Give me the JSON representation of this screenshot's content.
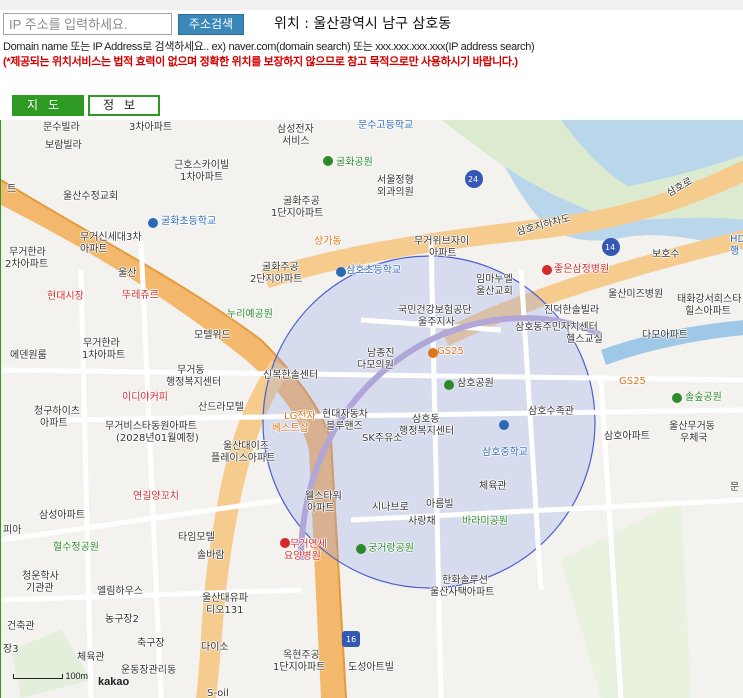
{
  "search": {
    "placeholder": "IP 주소를 입력하세요.",
    "button_label": "주소검색"
  },
  "location_text": "위치 : 울산광역시 남구 삼호동",
  "help_text": "Domain name 또는 IP Address로 검색하세요.. ex) naver.com(domain search) 또는 xxx.xxx.xxx.xxx(IP address search)",
  "warning_text": "(*제공되는 위치서비스는 법적 효력이 없으며 정확한 위치를 보장하지 않으므로 참고 목적으로만 사용하시기 바랍니다.)",
  "tabs": [
    {
      "label": "지도"
    },
    {
      "label": "정보"
    }
  ],
  "map": {
    "labels": [
      "문수빌라",
      "3차아파트",
      "삼성전자",
      "서비스",
      "문수고등학교",
      "보람빌라",
      "근호스카이빌",
      "1차아파트",
      "굴화공원",
      "서울정형",
      "외과의원",
      "울산수정교회",
      "굴화초등학교",
      "굴화주공",
      "1단지아파트",
      "무거신세대3차",
      "아파트",
      "상가동",
      "무거위브자이",
      "아파트",
      "무거한라",
      "2차아파트",
      "울산",
      "굴화주공",
      "2단지아파트",
      "삼호초등학교",
      "임마누엘",
      "울산교회",
      "좋은삼정병원",
      "보호수",
      "울산미즈병원",
      "태화강서희스타",
      "힐스아파트",
      "현대시장",
      "뚜레쥬르",
      "누리예공원",
      "국민건강보험공단",
      "울주지사",
      "진덕한솔빌라",
      "모텔위드",
      "무거한라",
      "1차아파트",
      "삼호동주민자치센터",
      "헬스교실",
      "다모아파트",
      "에덴원룸",
      "남종진",
      "다모의원",
      "GS25",
      "신복한솔센터",
      "무거동",
      "행정복지센터",
      "삼호공원",
      "이디야커피",
      "GS25",
      "산드라모텔",
      "솔숲공원",
      "청구하이츠",
      "아파트",
      "LG전자",
      "베스트샵",
      "현대자동차",
      "블루핸즈",
      "삼호동",
      "행정복지센터",
      "삼호수족관",
      "울산무거동",
      "우체국",
      "무거비스타동원아파트",
      "(2028년01월예정)",
      "울산대이즈",
      "플레이스아파트",
      "SK주유소",
      "삼호중학교",
      "삼호아파트",
      "체육관",
      "삼성아파트",
      "연길양꼬치",
      "웰스타워",
      "아파트",
      "아름빌",
      "시나브로",
      "사랑채",
      "바라미공원",
      "타임모텔",
      "솔바람",
      "혈수정공원",
      "무거연세",
      "요양병원",
      "궁거랑공원",
      "청운학사",
      "기관관",
      "엘림하우스",
      "한화솔루션",
      "울산사택아파트",
      "울산대유파",
      "티오131",
      "농구장2",
      "축구장",
      "체육관",
      "운동장관리동",
      "다이소",
      "옥현주공",
      "1단지아파트",
      "도성아트빌",
      "건축관",
      "문",
      "궁",
      "대공원",
      "장3",
      "해수",
      "S-oil",
      "물드",
      "HD",
      "행",
      "트",
      "피아",
      "트"
    ],
    "road_numbers": [
      "24",
      "14",
      "16"
    ],
    "road_name": "삼호지하차도",
    "road_name_2": "삼호로",
    "scale_label": "100m",
    "brand": "kakao"
  },
  "colors": {
    "accent_green": "#2f9a23",
    "button_blue": "#3a88b8",
    "warning_red": "#d40000",
    "highlight_circle": "#4a5fd0"
  }
}
